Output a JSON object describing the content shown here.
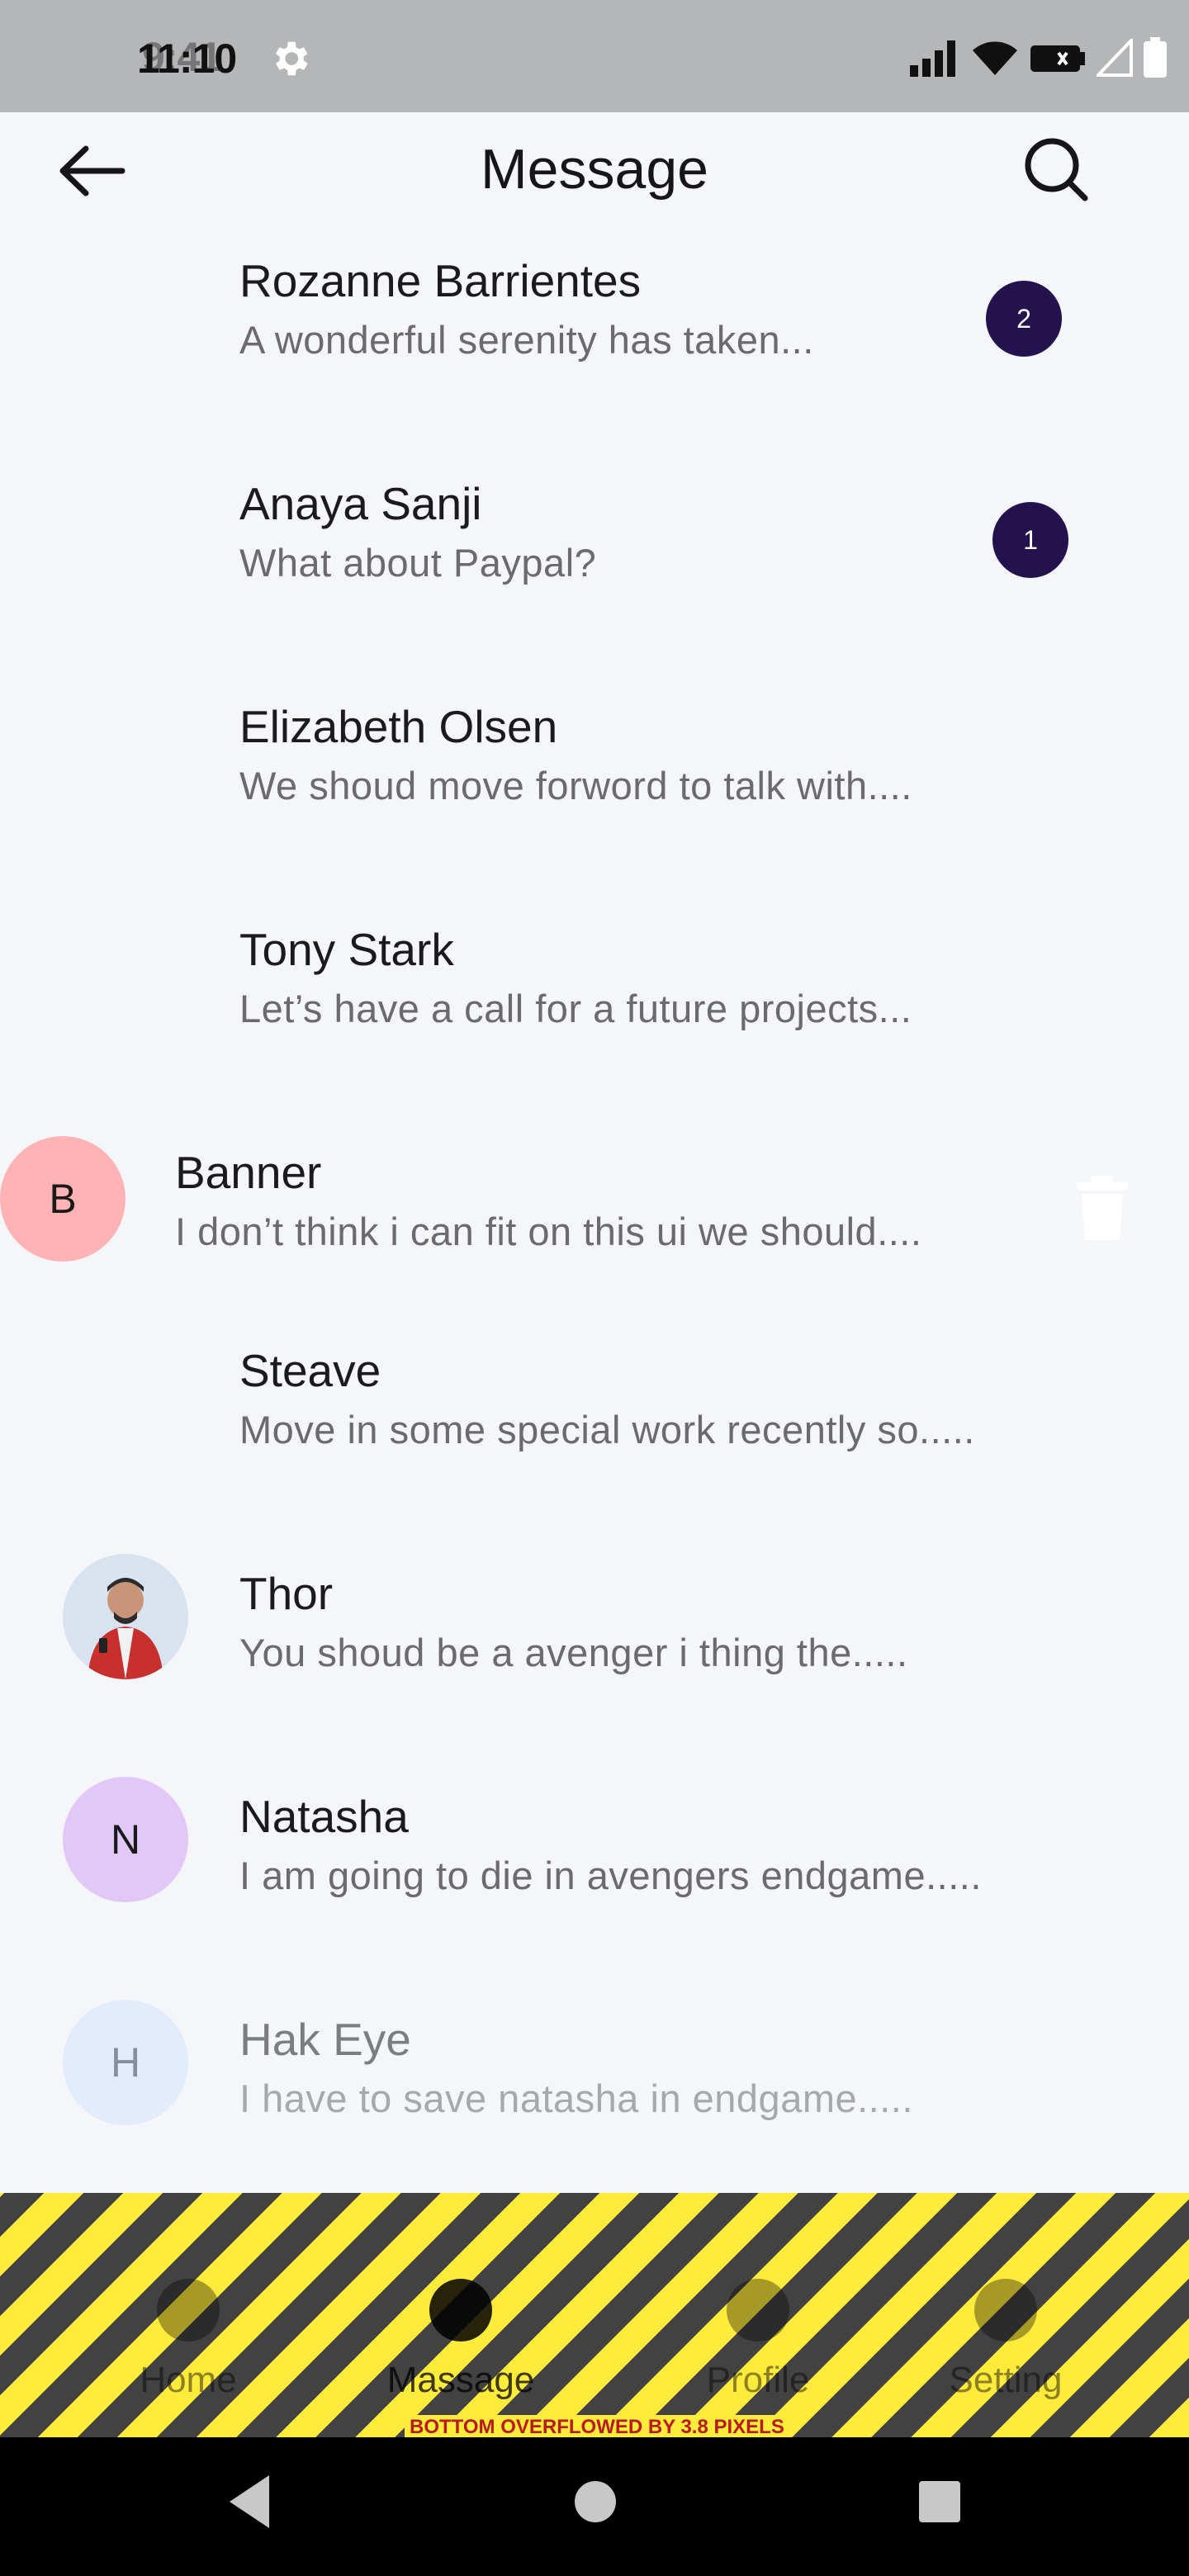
{
  "status_bar": {
    "time": "11:10",
    "time_overlap": "9:41"
  },
  "app_bar": {
    "title": "Message"
  },
  "conversations": [
    {
      "name": "Rozanne Barrientes",
      "preview": "A wonderful serenity has taken...",
      "unread": "2"
    },
    {
      "name": "Anaya Sanji",
      "preview": "What about Paypal?",
      "unread": "1"
    },
    {
      "name": "Elizabeth Olsen",
      "preview": "We shoud move forword to talk with...."
    },
    {
      "name": "Tony Stark",
      "preview": "Let’s have a call for a future projects..."
    },
    {
      "name": "Banner",
      "preview": "I don’t think i can fit on this ui we should....",
      "initial": "B",
      "avatar_color": "#ffb3b5",
      "swiped": true
    },
    {
      "name": "Steave",
      "preview": "Move in some special work recently so....."
    },
    {
      "name": "Thor",
      "preview": "You shoud be a avenger i thing the.....",
      "avatar": "photo"
    },
    {
      "name": "Natasha",
      "preview": "I am going to die in avengers endgame.....",
      "initial": "N",
      "avatar_color": "#e2c8f7"
    },
    {
      "name": "Hak Eye",
      "preview": "I have to save natasha in endgame.....",
      "initial": "H",
      "avatar_color": "#d4e4fa",
      "faded": true
    }
  ],
  "bottom_nav": {
    "items": [
      "Home",
      "Massage",
      "Profile",
      "Setting"
    ]
  },
  "overflow_warning": "BOTTOM OVERFLOWED BY 3.8 PIXELS",
  "colors": {
    "badge": "#24124f",
    "background": "#f4f6fa",
    "overflow_yellow": "#ffeb3b",
    "overflow_text": "#b71c1c"
  },
  "icons": [
    "back-arrow-icon",
    "search-icon",
    "trash-icon",
    "settings-gear-icon",
    "signal-icon",
    "wifi-icon",
    "battery-icon"
  ]
}
